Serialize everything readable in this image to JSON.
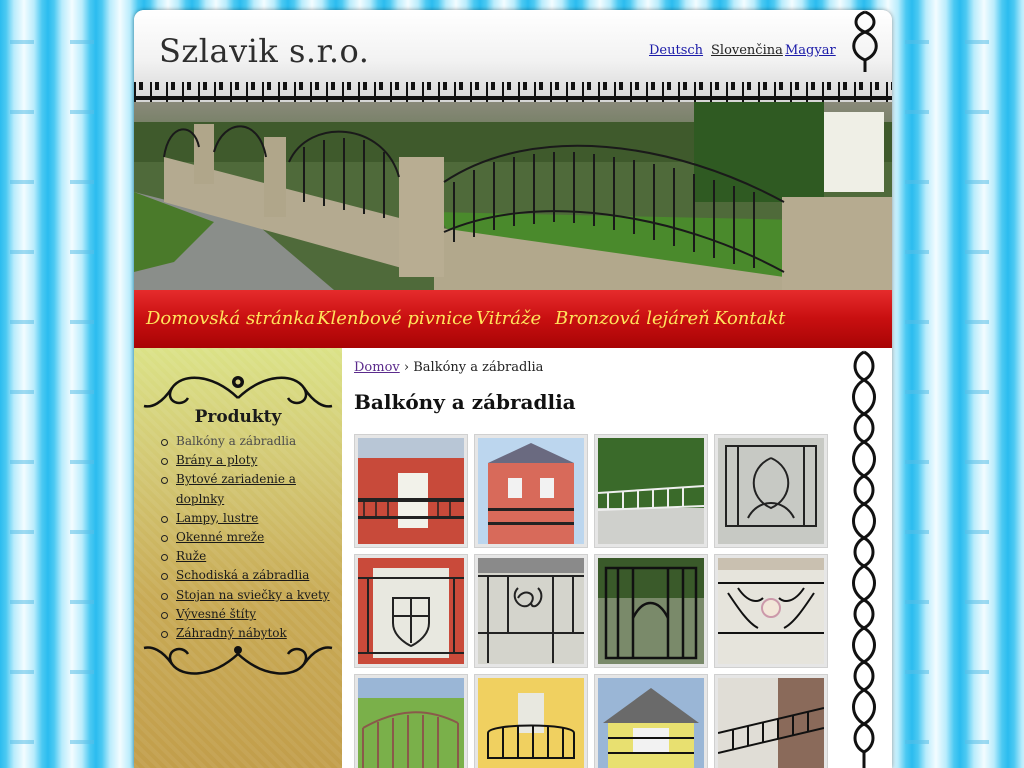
{
  "site": {
    "logo": "Szlavik s.r.o."
  },
  "languages": [
    {
      "label": "Deutsch",
      "active": false
    },
    {
      "label": "Slovenčina",
      "active": true
    },
    {
      "label": "Magyar",
      "active": false
    }
  ],
  "nav": [
    "Domovská stránka",
    "Klenbové pivnice",
    "Vitráže",
    "Bronzová lejáreň",
    "Kontakt"
  ],
  "sidebar": {
    "title": "Produkty",
    "items": [
      "Balkóny a zábradlia",
      "Brány a ploty",
      "Bytové zariadenie a doplnky",
      "Lampy, lustre",
      "Okenné mreže",
      "Ruže",
      "Schodiská a zábradlia",
      "Stojan na sviečky a kvety",
      "Vývesné štíty",
      "Záhradný nábytok"
    ],
    "current_index": 0
  },
  "breadcrumb": {
    "home": "Domov",
    "separator": "›",
    "current": "Balkóny a zábradlia"
  },
  "page_title": "Balkóny a zábradlia",
  "colors": {
    "nav_bg": "#c80f10",
    "nav_text": "#ffe45c",
    "link": "#1a1aa8",
    "visited": "#5b2b8c"
  }
}
